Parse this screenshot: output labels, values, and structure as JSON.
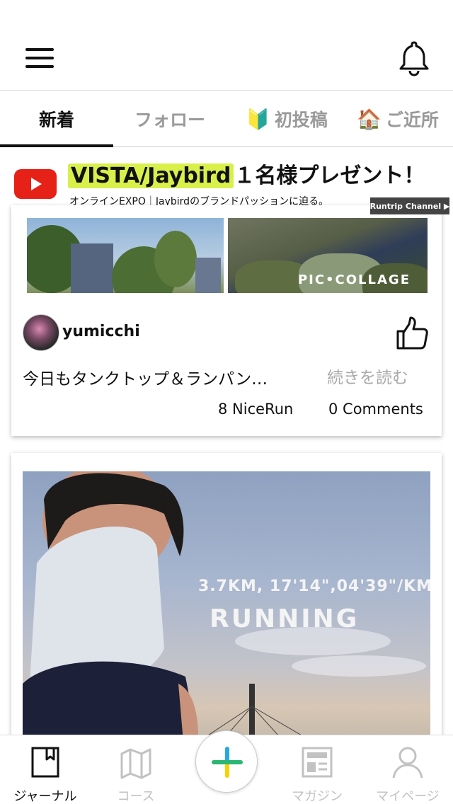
{
  "tabs": [
    {
      "label": "新着",
      "emoji": ""
    },
    {
      "label": "フォロー",
      "emoji": ""
    },
    {
      "label": "初投稿",
      "emoji": "🔰"
    },
    {
      "label": "ご近所",
      "emoji": "🏠"
    }
  ],
  "banner": {
    "title_highlight": "VISTA/Jaybird",
    "title_rest": "１名様プレゼント！",
    "subtitle": "オンラインEXPO｜Jaybirdのブランドパッションに迫る。",
    "channel_button": "Runtrip Channel ▶"
  },
  "post1": {
    "collage_watermark": "PIC•COLLAGE",
    "username": "yumicchi",
    "excerpt": "今日もタンクトップ＆ランパン…",
    "read_more": "続きを読む",
    "nicerun": "8 NiceRun",
    "comments": "0 Comments"
  },
  "post2": {
    "stats_text": "3.7KM, 17'14\",04'39\"/KM",
    "title_text": "RUNNING"
  },
  "bottom_nav": [
    {
      "label": "ジャーナル",
      "icon": "book-icon"
    },
    {
      "label": "コース",
      "icon": "map-icon"
    },
    {
      "label": "マガジン",
      "icon": "magazine-icon"
    },
    {
      "label": "マイページ",
      "icon": "user-icon"
    }
  ],
  "colors": {
    "accent_highlight": "#d9f04a",
    "plus_green": "#2bb673",
    "plus_yellow": "#f5d300",
    "plus_blue": "#29a8e0",
    "youtube_red": "#e62117"
  }
}
